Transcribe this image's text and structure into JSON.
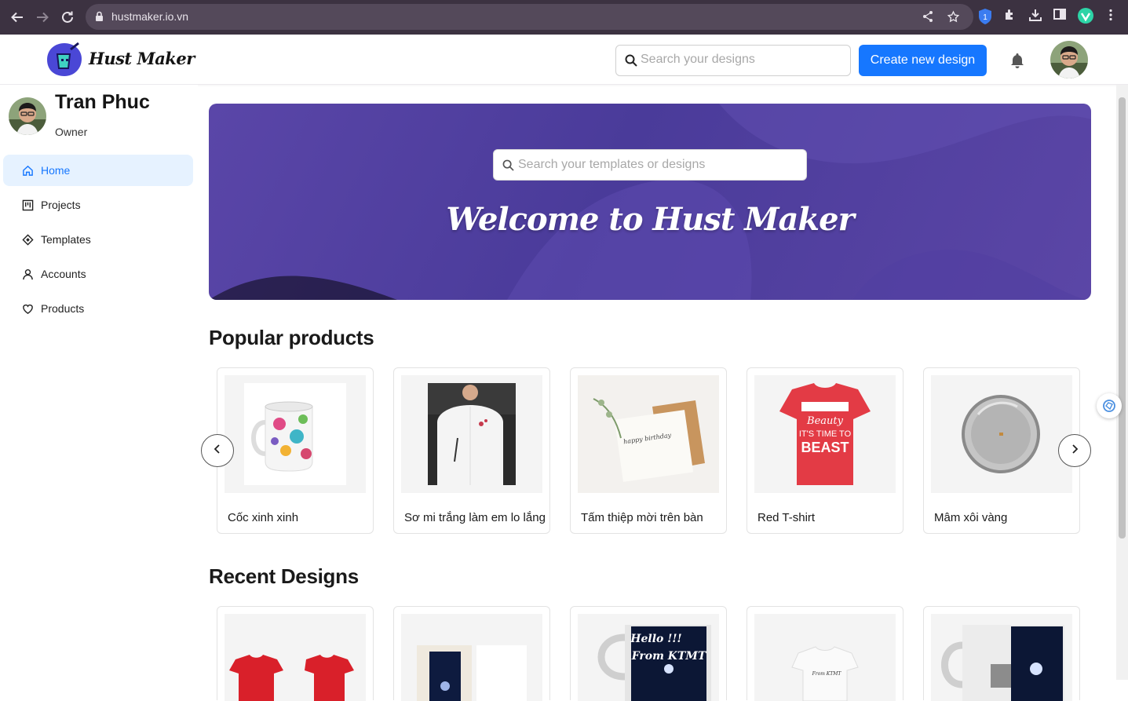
{
  "browser": {
    "url": "hustmaker.io.vn",
    "extension_badge": "1"
  },
  "header": {
    "logo_text": "Hust Maker",
    "search_placeholder": "Search your designs",
    "create_button": "Create new design"
  },
  "profile": {
    "name": "Tran Phuc",
    "role": "Owner"
  },
  "sidebar": {
    "items": [
      {
        "label": "Home",
        "icon": "home-icon",
        "active": true
      },
      {
        "label": "Projects",
        "icon": "projects-icon",
        "active": false
      },
      {
        "label": "Templates",
        "icon": "templates-icon",
        "active": false
      },
      {
        "label": "Accounts",
        "icon": "user-icon",
        "active": false
      },
      {
        "label": "Products",
        "icon": "heart-icon",
        "active": false
      }
    ]
  },
  "hero": {
    "search_placeholder": "Search your templates or designs",
    "title": "Welcome to Hust Maker"
  },
  "popular": {
    "title": "Popular products",
    "items": [
      {
        "name": "Cốc xinh xinh"
      },
      {
        "name": "Sơ mi trắng làm em lo lắng"
      },
      {
        "name": "Tấm thiệp mời trên bàn"
      },
      {
        "name": "Red T-shirt"
      },
      {
        "name": "Mâm xôi vàng"
      }
    ]
  },
  "recent": {
    "title": "Recent Designs"
  },
  "colors": {
    "accent": "#1677ff",
    "hero": "#4f3ea0",
    "chrome": "#3c3241"
  }
}
